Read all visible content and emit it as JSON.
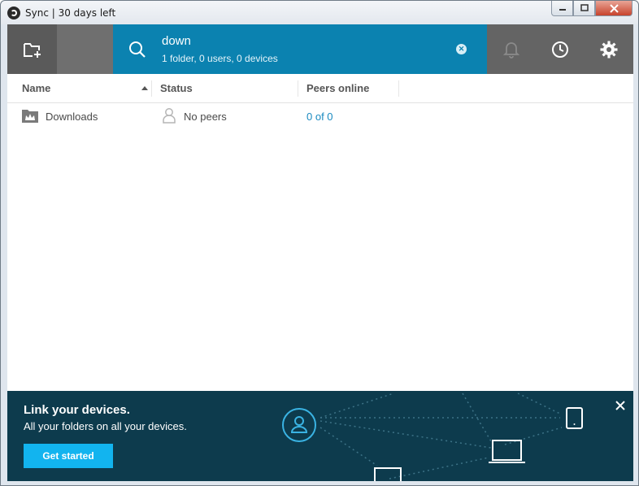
{
  "window": {
    "title": "Sync | 30 days left",
    "icon": "sync-app-icon",
    "controls": {
      "minimize": "minimize-icon",
      "maximize": "maximize-icon",
      "close": "close-icon"
    }
  },
  "toolbar": {
    "add_folder_icon": "add-folder-icon",
    "search": {
      "query": "down",
      "summary": "1 folder, 0 users, 0 devices",
      "icon": "search-icon",
      "clear_icon": "clear-icon"
    },
    "notifications_icon": "bell-icon",
    "history_icon": "clock-icon",
    "settings_icon": "gear-icon"
  },
  "table": {
    "columns": [
      {
        "label": "Name",
        "sorted": "ascending"
      },
      {
        "label": "Status"
      },
      {
        "label": "Peers online"
      }
    ],
    "rows": [
      {
        "name": "Downloads",
        "status": "No peers",
        "peers": "0 of 0"
      }
    ]
  },
  "banner": {
    "title": "Link your devices.",
    "subtitle": "All your folders on all your devices.",
    "cta": "Get started",
    "close_icon": "close-icon"
  },
  "colors": {
    "accent": "#0b82b0",
    "toolbar": "#646464",
    "banner": "#0d3b4d",
    "cta": "#12b4ef",
    "link": "#1a8ac0"
  }
}
